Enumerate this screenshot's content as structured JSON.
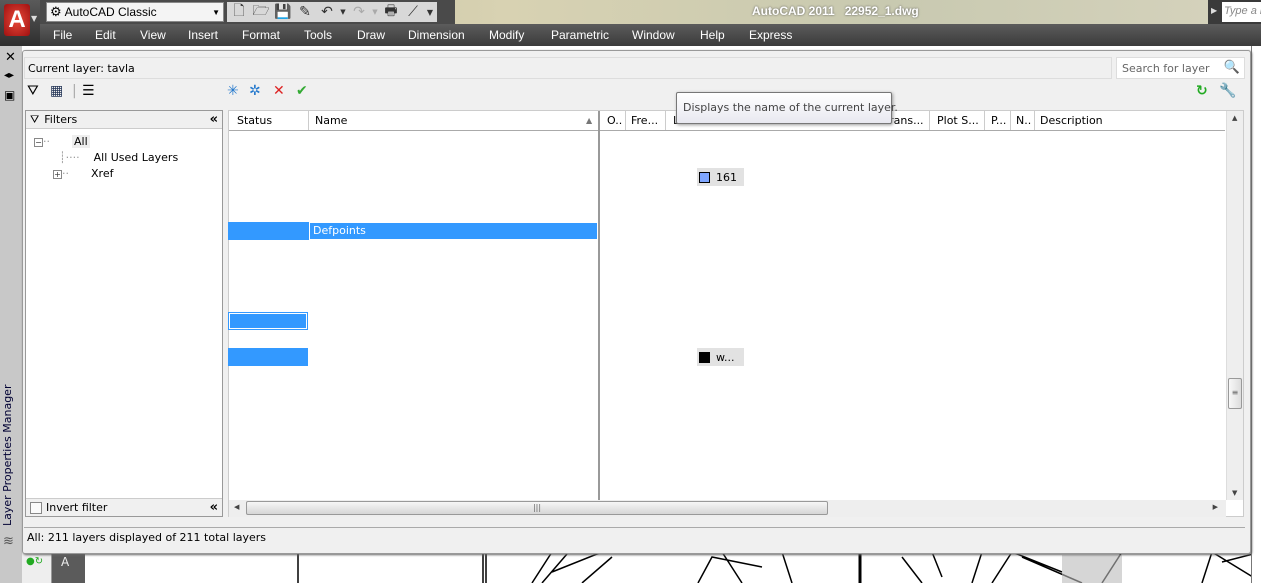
{
  "app": {
    "title": "AutoCAD 2011",
    "file": "22952_1.dwg",
    "help_search_placeholder": "Type a k"
  },
  "workspace": {
    "selected": "AutoCAD Classic"
  },
  "menu": [
    "File",
    "Edit",
    "View",
    "Insert",
    "Format",
    "Tools",
    "Draw",
    "Dimension",
    "Modify",
    "Parametric",
    "Window",
    "Help",
    "Express"
  ],
  "palette": {
    "vertical_title": "Layer Properties Manager",
    "current_layer": "Current layer: tavla",
    "search_placeholder": "Search for layer",
    "filters": {
      "header": "Filters",
      "items": [
        "All",
        "All Used Layers",
        "Xref"
      ],
      "invert_label": "Invert filter",
      "invert_checked": false
    },
    "columns": [
      "Status",
      "Name",
      "O..",
      "Fre...",
      "L",
      "Trans...",
      "Plot S...",
      "P...",
      "N..",
      "Description"
    ],
    "rows": {
      "selected_name": "Defpoints",
      "color_161": "161",
      "color_w": "w..."
    },
    "colors": {
      "color_161": "#7fa6ff",
      "color_w": "#000000",
      "selection": "#3399ff"
    },
    "tooltip": "Displays the name of the current layer.",
    "status": "All: 211 layers displayed of 211 total layers"
  }
}
